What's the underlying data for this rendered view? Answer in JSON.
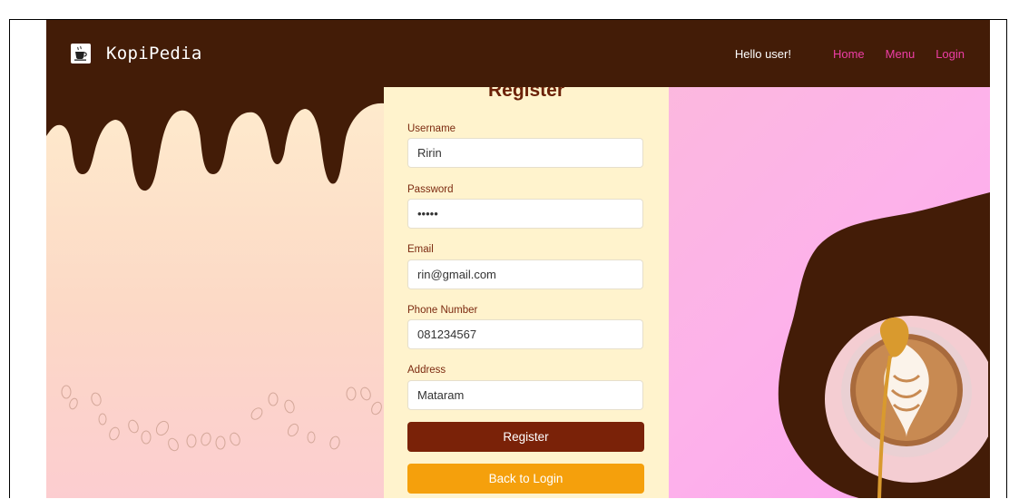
{
  "navbar": {
    "brand": "KopiPedia",
    "greeting": "Hello user!",
    "links": {
      "home": "Home",
      "menu": "Menu",
      "login": "Login"
    }
  },
  "form": {
    "title": "Register",
    "fields": {
      "username": {
        "label": "Username",
        "value": "Ririn"
      },
      "password": {
        "label": "Password",
        "value": "ririn"
      },
      "email": {
        "label": "Email",
        "value": "rin@gmail.com"
      },
      "phone": {
        "label": "Phone Number",
        "value": "081234567"
      },
      "address": {
        "label": "Address",
        "value": "Mataram"
      }
    },
    "buttons": {
      "register": "Register",
      "back": "Back to Login"
    }
  },
  "colors": {
    "navbar": "#431c07",
    "nav_link": "#ee3ea6",
    "register_button": "#7a2208",
    "back_button": "#f5a00c",
    "form_panel": "#fff3cd"
  },
  "icons": {
    "brand": "coffee-cup-icon"
  }
}
